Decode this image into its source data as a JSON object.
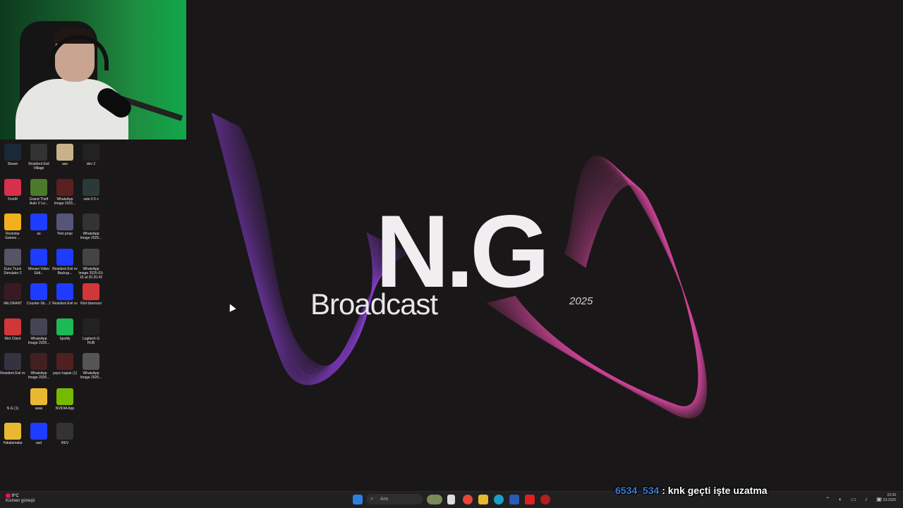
{
  "brand": {
    "main": "N.G",
    "sub": "Broadcast",
    "year": "2025"
  },
  "colors": {
    "background": "#1a1718",
    "wave_left": "#8a3fd0",
    "wave_right": "#d0479a",
    "chat_user": "#3a7bd5"
  },
  "desktop_icons": [
    {
      "label": "Steam",
      "icon": "steam-icon",
      "color": "#1b2838"
    },
    {
      "label": "Resident Evil Village",
      "icon": "game-icon",
      "color": "#333"
    },
    {
      "label": "ase",
      "icon": "image-icon",
      "color": "#c9b28a"
    },
    {
      "label": "dev 2",
      "icon": "video-icon",
      "color": "#222"
    },
    {
      "label": "FiveM",
      "icon": "fivem-icon",
      "color": "#d6304b"
    },
    {
      "label": "Grand Theft Auto V Le...",
      "icon": "gta-icon",
      "color": "#4a7a2a"
    },
    {
      "label": "WhatsApp Image 2025...",
      "icon": "image-icon",
      "color": "#5a2020"
    },
    {
      "label": "valo 5 5 v",
      "icon": "video-icon",
      "color": "#2a3a3a"
    },
    {
      "label": "Rockstar Games ...",
      "icon": "rockstar-icon",
      "color": "#f2b01e"
    },
    {
      "label": "as",
      "icon": "file-icon",
      "color": "#1e3cff"
    },
    {
      "label": "Yeni proje",
      "icon": "image-icon",
      "color": "#557"
    },
    {
      "label": "WhatsApp Image 2025...",
      "icon": "image-icon",
      "color": "#333"
    },
    {
      "label": "Euro Truck Simulator 2",
      "icon": "truck-icon",
      "color": "#556"
    },
    {
      "label": "Movavi Video Edit...",
      "icon": "file-icon",
      "color": "#1e3cff"
    },
    {
      "label": "Resident Evil vv Backup...",
      "icon": "file-icon",
      "color": "#1e3cff"
    },
    {
      "label": "WhatsApp Image 2025-03-16 at 20.20.42",
      "icon": "image-icon",
      "color": "#444"
    },
    {
      "label": "VALORANT",
      "icon": "valorant-icon",
      "color": "#3a1a22"
    },
    {
      "label": "Counter-Str... 2",
      "icon": "cs-icon",
      "color": "#1e3cff"
    },
    {
      "label": "Resident Evil vv",
      "icon": "file-icon",
      "color": "#1e3cff"
    },
    {
      "label": "Riot İstemcisi",
      "icon": "riot-icon",
      "color": "#d13639"
    },
    {
      "label": "Riot Client",
      "icon": "riot-icon",
      "color": "#d13639"
    },
    {
      "label": "WhatsApp Image 2026...",
      "icon": "image-icon",
      "color": "#445"
    },
    {
      "label": "Spotify",
      "icon": "spotify-icon",
      "color": "#1db954"
    },
    {
      "label": "Logitech G HUB",
      "icon": "logitech-icon",
      "color": "#222"
    },
    {
      "label": "Resident Evil vv",
      "icon": "image-icon",
      "color": "#334"
    },
    {
      "label": "WhatsApp Image 2026...",
      "icon": "image-icon",
      "color": "#402020"
    },
    {
      "label": "yayın kapalı (1)",
      "icon": "image-icon",
      "color": "#502020"
    },
    {
      "label": "WhatsApp Image 2026...",
      "icon": "image-icon",
      "color": "#555"
    },
    {
      "label": "N.G (1)",
      "icon": "image-icon",
      "color": "#1a1718"
    },
    {
      "label": "asas",
      "icon": "folder-icon",
      "color": "#e8b830"
    },
    {
      "label": "NVIDIA App",
      "icon": "nvidia-icon",
      "color": "#76b900"
    },
    {
      "label": "Yakalamalar",
      "icon": "folder-icon",
      "color": "#e8b830"
    },
    {
      "label": "asd",
      "icon": "file-icon",
      "color": "#1e3cff"
    },
    {
      "label": "REV",
      "icon": "image-icon",
      "color": "#333"
    }
  ],
  "taskbar": {
    "weather_temp": "9°C",
    "weather_desc": "Kısmen güneşli",
    "search_placeholder": "Ara",
    "apps": [
      "start-icon",
      "search-icon",
      "widgets-icon",
      "task-view-icon",
      "chrome-icon",
      "file-explorer-icon",
      "edge-icon",
      "store-icon",
      "youtube-icon",
      "app-icon"
    ],
    "time": "22:26",
    "date": "17.03.2026"
  },
  "chat": {
    "user": "6534_534",
    "message": ": knk geçti işte uzatma"
  }
}
